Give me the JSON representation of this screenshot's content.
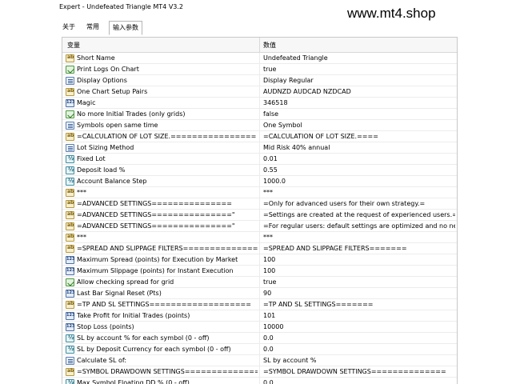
{
  "window": {
    "title": "Expert - Undefeated Triangle MT4 V3.2",
    "watermark": "www.mt4.shop"
  },
  "tabs": [
    {
      "label": "关于"
    },
    {
      "label": "常用"
    },
    {
      "label": "输入参数"
    }
  ],
  "table": {
    "headers": {
      "variable": "变量",
      "value": "数值"
    },
    "rows": [
      {
        "icon": "ab",
        "name": "Short Name",
        "value": "Undefeated Triangle"
      },
      {
        "icon": "bool",
        "name": "Print Logs On Chart",
        "value": "true"
      },
      {
        "icon": "enm",
        "name": "Display Options",
        "value": "Display Regular"
      },
      {
        "icon": "ab",
        "name": "One Chart Setup Pairs",
        "value": "AUDNZD AUDCAD NZDCAD"
      },
      {
        "icon": "num",
        "name": "Magic",
        "value": "346518"
      },
      {
        "icon": "bool",
        "name": "No more Initial Trades (only grids)",
        "value": "false"
      },
      {
        "icon": "enm",
        "name": "Symbols open same time",
        "value": "One Symbol"
      },
      {
        "icon": "ab",
        "name": "=CALCULATION OF LOT SIZE.================",
        "value": "=CALCULATION OF LOT SIZE.===="
      },
      {
        "icon": "enm",
        "name": "Lot Sizing Method",
        "value": "Mid Risk 40% annual"
      },
      {
        "icon": "dbl",
        "name": "Fixed Lot",
        "value": "0.01"
      },
      {
        "icon": "dbl",
        "name": "Deposit load %",
        "value": "0.55"
      },
      {
        "icon": "dbl",
        "name": "Account Balance Step",
        "value": "1000.0"
      },
      {
        "icon": "ab",
        "name": "***",
        "value": "***"
      },
      {
        "icon": "ab",
        "name": "=ADVANCED SETTINGS===============",
        "value": "=Only for advanced users for their own strategy.="
      },
      {
        "icon": "ab",
        "name": "=ADVANCED SETTINGS===============\"",
        "value": "=Settings are created at the request of experienced users.="
      },
      {
        "icon": "ab",
        "name": "=ADVANCED SETTINGS===============\"",
        "value": "=For regular users: default settings are optimized and no ne..."
      },
      {
        "icon": "ab",
        "name": "***",
        "value": "***"
      },
      {
        "icon": "ab",
        "name": "=SPREAD AND SLIPPAGE FILTERS==================...",
        "value": "=SPREAD AND SLIPPAGE FILTERS======="
      },
      {
        "icon": "num",
        "name": "Maximum Spread (points) for Execution by Market",
        "value": "100"
      },
      {
        "icon": "num",
        "name": "Maximum Slippage (points) for Instant Execution",
        "value": "100"
      },
      {
        "icon": "bool",
        "name": "Allow checking spread for grid",
        "value": "true"
      },
      {
        "icon": "num",
        "name": "Last Bar Signal Reset (Pts)",
        "value": "90"
      },
      {
        "icon": "ab",
        "name": "=TP AND SL SETTINGS===================",
        "value": "=TP AND SL SETTINGS======="
      },
      {
        "icon": "num",
        "name": "Take Profit for Initial Trades (points)",
        "value": "101"
      },
      {
        "icon": "num",
        "name": "Stop Loss (points)",
        "value": "10000"
      },
      {
        "icon": "dbl",
        "name": "SL by account % for each symbol (0 - off)",
        "value": "0.0"
      },
      {
        "icon": "dbl",
        "name": "SL by Deposit Currency for each symbol (0 - off)",
        "value": "0.0"
      },
      {
        "icon": "enm",
        "name": "Calculate SL of:",
        "value": "SL by account %"
      },
      {
        "icon": "ab",
        "name": "=SYMBOL DRAWDOWN SETTINGS===============",
        "value": "=SYMBOL DRAWDOWN SETTINGS=============="
      },
      {
        "icon": "dbl",
        "name": "Max Symbol Floating DD % (0 - off)",
        "value": "0.0"
      }
    ]
  }
}
